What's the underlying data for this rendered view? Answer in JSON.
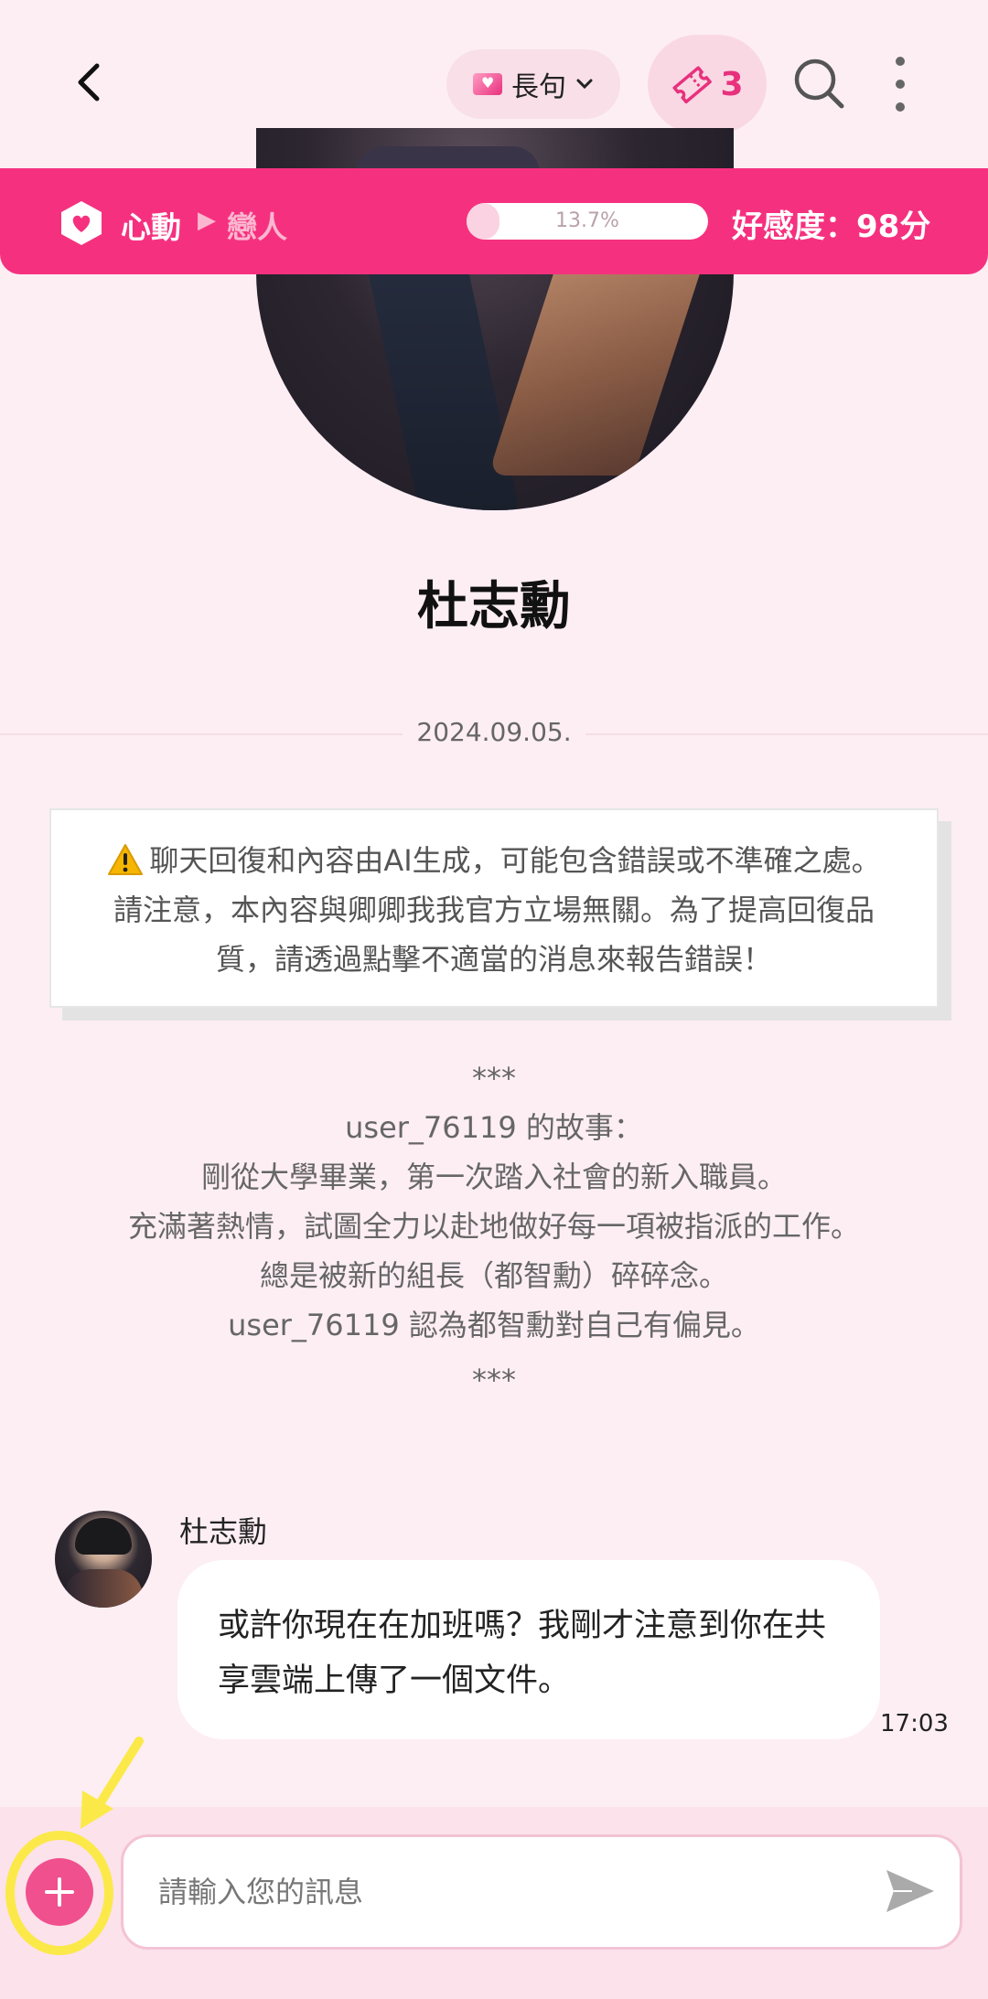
{
  "header": {
    "mode_label": "長句",
    "ticket_count": "3"
  },
  "relation": {
    "stage_current": "心動",
    "stage_next": "戀人",
    "progress_text": "13.7%",
    "progress_value": 0.137,
    "favor_text": "好感度：98分",
    "bar_color": "#f5317f"
  },
  "character": {
    "name": "杜志勳"
  },
  "chat": {
    "date": "2024.09.05.",
    "notice": "聊天回復和內容由AI生成，可能包含錯誤或不準確之處。請注意，本內容與卿卿我我官方立場無關。為了提高回復品質，請透過點擊不適當的消息來報告錯誤！",
    "story": {
      "stars_top": "***",
      "title": "user_76119 的故事：",
      "line1": "剛從大學畢業，第一次踏入社會的新入職員。",
      "line2": "充滿著熱情，試圖全力以赴地做好每一項被指派的工作。",
      "line3": "總是被新的組長（都智勳）碎碎念。",
      "line4": "user_76119 認為都智勳對自己有偏見。",
      "stars_bottom": "***"
    },
    "messages": [
      {
        "sender": "杜志勳",
        "text": "或許你現在在加班嗎？我剛才注意到你在共享雲端上傳了一個文件。",
        "time": "17:03"
      }
    ]
  },
  "composer": {
    "placeholder": "請輸入您的訊息",
    "value": ""
  },
  "colors": {
    "accent": "#f5317f",
    "background": "#fdeef4",
    "annotation": "#fbe94a"
  }
}
